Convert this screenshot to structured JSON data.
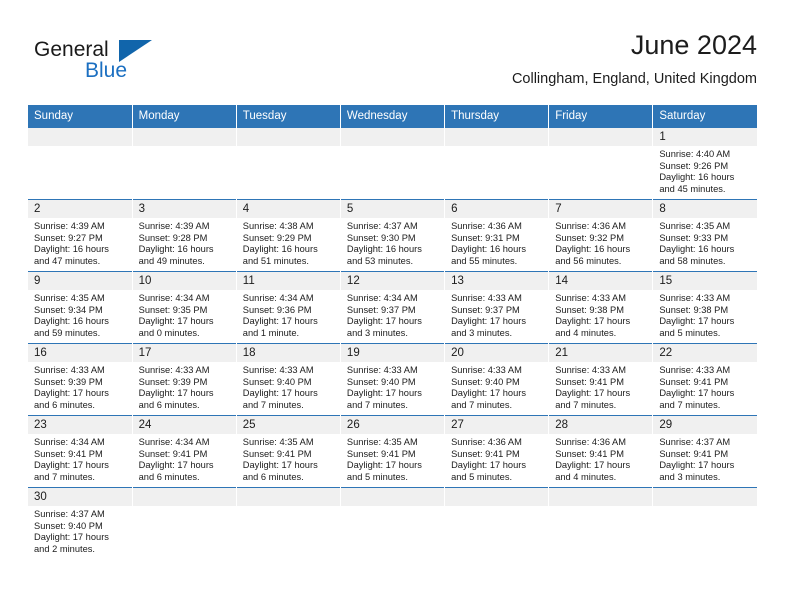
{
  "logo": {
    "word1": "General",
    "word2": "Blue",
    "triangle_icon": "triangle-icon",
    "blue": "#1165ab"
  },
  "header": {
    "title": "June 2024",
    "subtitle": "Collingham, England, United Kingdom"
  },
  "theme": {
    "header_blue": "#2e75b6",
    "daynum_bg": "#f0f0f0",
    "text": "#1c1c1c"
  },
  "weekdays": [
    "Sunday",
    "Monday",
    "Tuesday",
    "Wednesday",
    "Thursday",
    "Friday",
    "Saturday"
  ],
  "weeks": [
    [
      {
        "day": "",
        "blank": true
      },
      {
        "day": "",
        "blank": true
      },
      {
        "day": "",
        "blank": true
      },
      {
        "day": "",
        "blank": true
      },
      {
        "day": "",
        "blank": true
      },
      {
        "day": "",
        "blank": true
      },
      {
        "day": "1",
        "sunrise": "Sunrise: 4:40 AM",
        "sunset": "Sunset: 9:26 PM",
        "daylight1": "Daylight: 16 hours",
        "daylight2": "and 45 minutes."
      }
    ],
    [
      {
        "day": "2",
        "sunrise": "Sunrise: 4:39 AM",
        "sunset": "Sunset: 9:27 PM",
        "daylight1": "Daylight: 16 hours",
        "daylight2": "and 47 minutes."
      },
      {
        "day": "3",
        "sunrise": "Sunrise: 4:39 AM",
        "sunset": "Sunset: 9:28 PM",
        "daylight1": "Daylight: 16 hours",
        "daylight2": "and 49 minutes."
      },
      {
        "day": "4",
        "sunrise": "Sunrise: 4:38 AM",
        "sunset": "Sunset: 9:29 PM",
        "daylight1": "Daylight: 16 hours",
        "daylight2": "and 51 minutes."
      },
      {
        "day": "5",
        "sunrise": "Sunrise: 4:37 AM",
        "sunset": "Sunset: 9:30 PM",
        "daylight1": "Daylight: 16 hours",
        "daylight2": "and 53 minutes."
      },
      {
        "day": "6",
        "sunrise": "Sunrise: 4:36 AM",
        "sunset": "Sunset: 9:31 PM",
        "daylight1": "Daylight: 16 hours",
        "daylight2": "and 55 minutes."
      },
      {
        "day": "7",
        "sunrise": "Sunrise: 4:36 AM",
        "sunset": "Sunset: 9:32 PM",
        "daylight1": "Daylight: 16 hours",
        "daylight2": "and 56 minutes."
      },
      {
        "day": "8",
        "sunrise": "Sunrise: 4:35 AM",
        "sunset": "Sunset: 9:33 PM",
        "daylight1": "Daylight: 16 hours",
        "daylight2": "and 58 minutes."
      }
    ],
    [
      {
        "day": "9",
        "sunrise": "Sunrise: 4:35 AM",
        "sunset": "Sunset: 9:34 PM",
        "daylight1": "Daylight: 16 hours",
        "daylight2": "and 59 minutes."
      },
      {
        "day": "10",
        "sunrise": "Sunrise: 4:34 AM",
        "sunset": "Sunset: 9:35 PM",
        "daylight1": "Daylight: 17 hours",
        "daylight2": "and 0 minutes."
      },
      {
        "day": "11",
        "sunrise": "Sunrise: 4:34 AM",
        "sunset": "Sunset: 9:36 PM",
        "daylight1": "Daylight: 17 hours",
        "daylight2": "and 1 minute."
      },
      {
        "day": "12",
        "sunrise": "Sunrise: 4:34 AM",
        "sunset": "Sunset: 9:37 PM",
        "daylight1": "Daylight: 17 hours",
        "daylight2": "and 3 minutes."
      },
      {
        "day": "13",
        "sunrise": "Sunrise: 4:33 AM",
        "sunset": "Sunset: 9:37 PM",
        "daylight1": "Daylight: 17 hours",
        "daylight2": "and 3 minutes."
      },
      {
        "day": "14",
        "sunrise": "Sunrise: 4:33 AM",
        "sunset": "Sunset: 9:38 PM",
        "daylight1": "Daylight: 17 hours",
        "daylight2": "and 4 minutes."
      },
      {
        "day": "15",
        "sunrise": "Sunrise: 4:33 AM",
        "sunset": "Sunset: 9:38 PM",
        "daylight1": "Daylight: 17 hours",
        "daylight2": "and 5 minutes."
      }
    ],
    [
      {
        "day": "16",
        "sunrise": "Sunrise: 4:33 AM",
        "sunset": "Sunset: 9:39 PM",
        "daylight1": "Daylight: 17 hours",
        "daylight2": "and 6 minutes."
      },
      {
        "day": "17",
        "sunrise": "Sunrise: 4:33 AM",
        "sunset": "Sunset: 9:39 PM",
        "daylight1": "Daylight: 17 hours",
        "daylight2": "and 6 minutes."
      },
      {
        "day": "18",
        "sunrise": "Sunrise: 4:33 AM",
        "sunset": "Sunset: 9:40 PM",
        "daylight1": "Daylight: 17 hours",
        "daylight2": "and 7 minutes."
      },
      {
        "day": "19",
        "sunrise": "Sunrise: 4:33 AM",
        "sunset": "Sunset: 9:40 PM",
        "daylight1": "Daylight: 17 hours",
        "daylight2": "and 7 minutes."
      },
      {
        "day": "20",
        "sunrise": "Sunrise: 4:33 AM",
        "sunset": "Sunset: 9:40 PM",
        "daylight1": "Daylight: 17 hours",
        "daylight2": "and 7 minutes."
      },
      {
        "day": "21",
        "sunrise": "Sunrise: 4:33 AM",
        "sunset": "Sunset: 9:41 PM",
        "daylight1": "Daylight: 17 hours",
        "daylight2": "and 7 minutes."
      },
      {
        "day": "22",
        "sunrise": "Sunrise: 4:33 AM",
        "sunset": "Sunset: 9:41 PM",
        "daylight1": "Daylight: 17 hours",
        "daylight2": "and 7 minutes."
      }
    ],
    [
      {
        "day": "23",
        "sunrise": "Sunrise: 4:34 AM",
        "sunset": "Sunset: 9:41 PM",
        "daylight1": "Daylight: 17 hours",
        "daylight2": "and 7 minutes."
      },
      {
        "day": "24",
        "sunrise": "Sunrise: 4:34 AM",
        "sunset": "Sunset: 9:41 PM",
        "daylight1": "Daylight: 17 hours",
        "daylight2": "and 6 minutes."
      },
      {
        "day": "25",
        "sunrise": "Sunrise: 4:35 AM",
        "sunset": "Sunset: 9:41 PM",
        "daylight1": "Daylight: 17 hours",
        "daylight2": "and 6 minutes."
      },
      {
        "day": "26",
        "sunrise": "Sunrise: 4:35 AM",
        "sunset": "Sunset: 9:41 PM",
        "daylight1": "Daylight: 17 hours",
        "daylight2": "and 5 minutes."
      },
      {
        "day": "27",
        "sunrise": "Sunrise: 4:36 AM",
        "sunset": "Sunset: 9:41 PM",
        "daylight1": "Daylight: 17 hours",
        "daylight2": "and 5 minutes."
      },
      {
        "day": "28",
        "sunrise": "Sunrise: 4:36 AM",
        "sunset": "Sunset: 9:41 PM",
        "daylight1": "Daylight: 17 hours",
        "daylight2": "and 4 minutes."
      },
      {
        "day": "29",
        "sunrise": "Sunrise: 4:37 AM",
        "sunset": "Sunset: 9:41 PM",
        "daylight1": "Daylight: 17 hours",
        "daylight2": "and 3 minutes."
      }
    ],
    [
      {
        "day": "30",
        "sunrise": "Sunrise: 4:37 AM",
        "sunset": "Sunset: 9:40 PM",
        "daylight1": "Daylight: 17 hours",
        "daylight2": "and 2 minutes."
      },
      {
        "day": "",
        "blank": true
      },
      {
        "day": "",
        "blank": true
      },
      {
        "day": "",
        "blank": true
      },
      {
        "day": "",
        "blank": true
      },
      {
        "day": "",
        "blank": true
      },
      {
        "day": "",
        "blank": true
      }
    ]
  ]
}
